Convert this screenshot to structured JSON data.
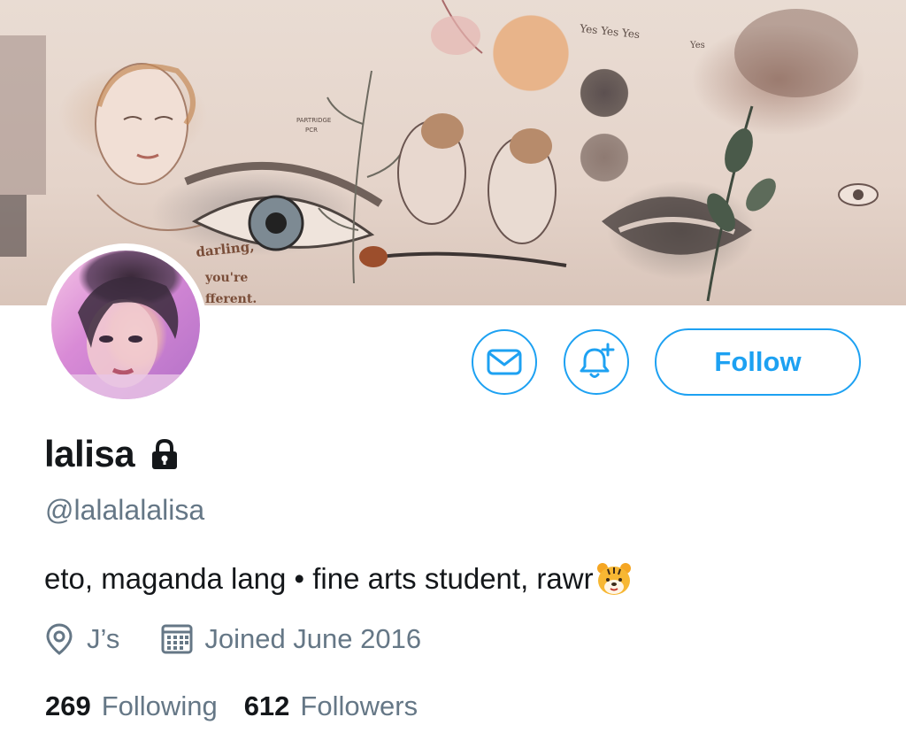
{
  "header_banner": {
    "image": "sketchbook-collage",
    "handwritten_text": [
      "darling,",
      "you're",
      "fferent.",
      "Yes Yes Yes",
      "Yes",
      "PARTRIDGE",
      "PCR"
    ]
  },
  "profile": {
    "display_name": "lalisa",
    "protected": true,
    "handle": "@lalalalalisa",
    "bio": "eto, maganda lang • fine arts student, rawr",
    "bio_emoji": "tiger-face",
    "location": "J’s",
    "joined": "Joined June 2016"
  },
  "actions": {
    "message_icon": "envelope-icon",
    "notify_icon": "bell-plus-icon",
    "follow_label": "Follow"
  },
  "stats": {
    "following_count": "269",
    "following_label": "Following",
    "followers_count": "612",
    "followers_label": "Followers"
  },
  "colors": {
    "accent": "#1da1f2",
    "secondary_text": "#657786",
    "primary_text": "#14171a"
  }
}
